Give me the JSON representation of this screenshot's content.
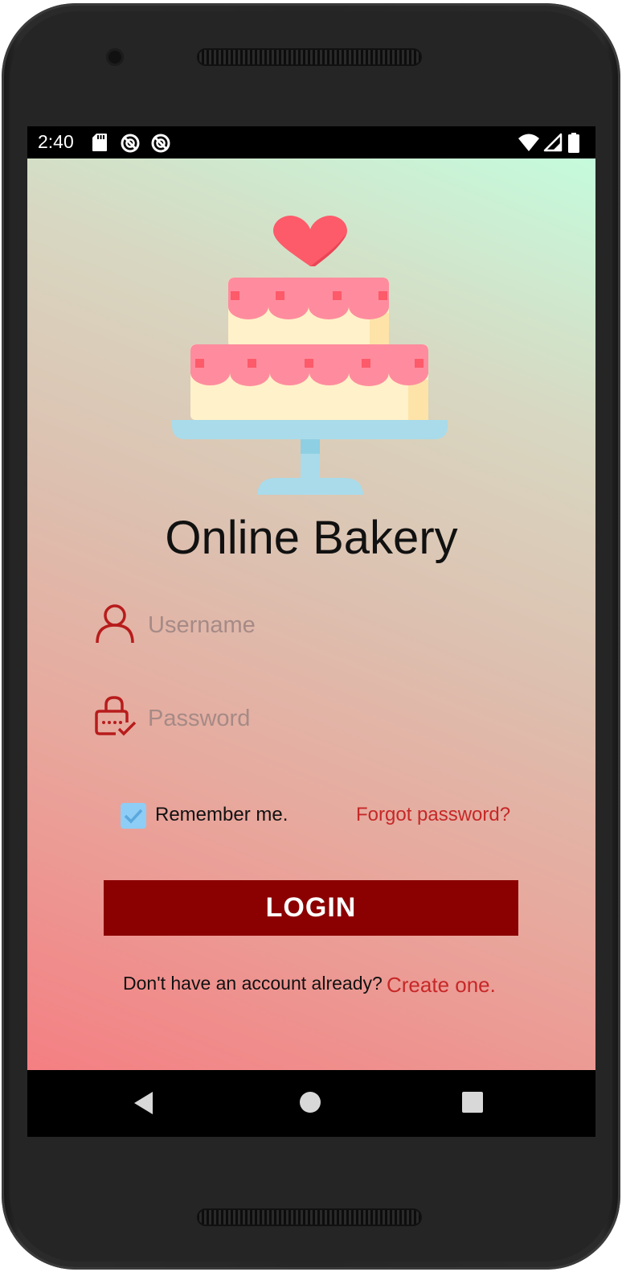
{
  "status_bar": {
    "time": "2:40",
    "left_icons": [
      "sd-card-icon",
      "sync-disabled-icon",
      "sync-disabled-icon"
    ],
    "right_icons": [
      "wifi-icon",
      "signal-icon",
      "battery-icon"
    ]
  },
  "app": {
    "logo": "cake-icon",
    "title": "Online Bakery",
    "username": {
      "placeholder": "Username",
      "value": "",
      "icon": "user-icon"
    },
    "password": {
      "placeholder": "Password",
      "value": "",
      "icon": "lock-icon"
    },
    "remember_me": {
      "label": "Remember me.",
      "checked": true
    },
    "forgot_password": "Forgot password?",
    "login_button": "LOGIN",
    "signup_prompt": "Don't have an account already?",
    "signup_link": "Create one."
  },
  "colors": {
    "primary": "#8b0000",
    "accent": "#c62828",
    "checkbox": "#8ecdf6",
    "gradient_start": "#f47f83",
    "gradient_end": "#c5fbdc"
  },
  "nav_bar": {
    "buttons": [
      "back-icon",
      "home-icon",
      "recents-icon"
    ]
  }
}
